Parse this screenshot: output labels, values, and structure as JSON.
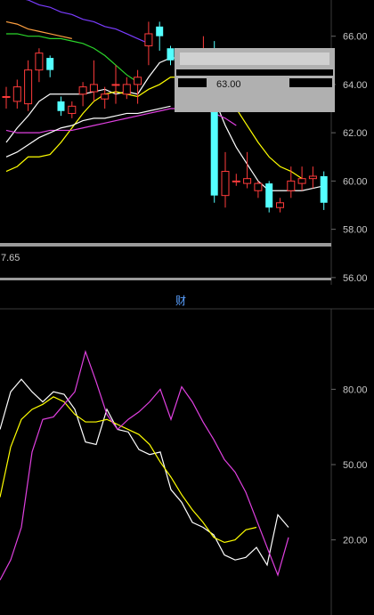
{
  "tab": {
    "label": "财"
  },
  "left_truncated_value": "7.65",
  "tooltip": {
    "value": "63.00"
  },
  "colors": {
    "background": "#000000",
    "panel_border": "#3a3a3a",
    "up_candle": "#ff3b3b",
    "down_candle": "#54ffff",
    "line_white": "#ffffff",
    "line_yellow": "#ffff00",
    "line_magenta": "#e040e0",
    "line_purple": "#7a3cff",
    "line_green": "#2bd62b",
    "line_orange": "#ffa040",
    "tooltip_bg": "#b0b0b0",
    "separator": "#9a9a9a"
  },
  "chart_data": [
    {
      "type": "candlestick",
      "title": "",
      "ylim": [
        55.7,
        67.5
      ],
      "yticks": [
        56.0,
        58.0,
        60.0,
        62.0,
        64.0,
        66.0
      ],
      "ytick_labels": [
        "56.00",
        "58.00",
        "60.00",
        "62.00",
        "64.00",
        "66.00"
      ],
      "candles": [
        {
          "o": 63.5,
          "c": 63.5,
          "h": 63.9,
          "l": 63.0
        },
        {
          "o": 63.3,
          "c": 63.9,
          "h": 64.2,
          "l": 63.0
        },
        {
          "o": 63.2,
          "c": 64.6,
          "h": 65.0,
          "l": 62.9
        },
        {
          "o": 64.6,
          "c": 65.3,
          "h": 65.5,
          "l": 64.1
        },
        {
          "o": 65.1,
          "c": 64.6,
          "h": 65.2,
          "l": 64.3
        },
        {
          "o": 63.3,
          "c": 62.9,
          "h": 63.5,
          "l": 62.7
        },
        {
          "o": 62.8,
          "c": 63.1,
          "h": 63.3,
          "l": 62.6
        },
        {
          "o": 63.6,
          "c": 63.9,
          "h": 64.1,
          "l": 63.1
        },
        {
          "o": 63.7,
          "c": 64.0,
          "h": 65.0,
          "l": 63.3
        },
        {
          "o": 63.4,
          "c": 63.6,
          "h": 63.9,
          "l": 63.0
        },
        {
          "o": 64.0,
          "c": 64.0,
          "h": 64.8,
          "l": 63.2
        },
        {
          "o": 63.6,
          "c": 64.0,
          "h": 64.3,
          "l": 63.4
        },
        {
          "o": 64.0,
          "c": 64.3,
          "h": 64.6,
          "l": 63.2
        },
        {
          "o": 65.6,
          "c": 66.1,
          "h": 66.6,
          "l": 64.8
        },
        {
          "o": 66.4,
          "c": 66.0,
          "h": 66.6,
          "l": 65.4
        },
        {
          "o": 65.5,
          "c": 65.0,
          "h": 65.6,
          "l": 64.8
        },
        {
          "o": 64.8,
          "c": 65.1,
          "h": 65.5,
          "l": 64.7
        },
        {
          "o": 64.9,
          "c": 64.1,
          "h": 65.0,
          "l": 63.7
        },
        {
          "o": 64.0,
          "c": 65.4,
          "h": 66.0,
          "l": 63.9
        },
        {
          "o": 65.5,
          "c": 59.4,
          "h": 65.8,
          "l": 59.1
        },
        {
          "o": 59.4,
          "c": 60.4,
          "h": 61.2,
          "l": 58.9
        },
        {
          "o": 60.0,
          "c": 60.0,
          "h": 60.3,
          "l": 59.8
        },
        {
          "o": 59.9,
          "c": 60.1,
          "h": 61.2,
          "l": 59.7
        },
        {
          "o": 59.6,
          "c": 59.9,
          "h": 60.0,
          "l": 59.3
        },
        {
          "o": 59.9,
          "c": 58.9,
          "h": 60.0,
          "l": 58.7
        },
        {
          "o": 58.9,
          "c": 59.1,
          "h": 59.3,
          "l": 58.7
        },
        {
          "o": 59.6,
          "c": 60.0,
          "h": 60.6,
          "l": 59.3
        },
        {
          "o": 59.9,
          "c": 60.1,
          "h": 60.6,
          "l": 59.6
        },
        {
          "o": 60.1,
          "c": 60.2,
          "h": 60.6,
          "l": 59.7
        },
        {
          "o": 60.2,
          "c": 59.1,
          "h": 60.4,
          "l": 58.8
        }
      ],
      "series": [
        {
          "color": "#ffffff",
          "values": [
            61.6,
            62.2,
            62.7,
            63.3,
            63.6,
            63.6,
            63.6,
            63.6,
            63.7,
            63.8,
            63.6,
            63.7,
            63.6,
            64.3,
            64.9,
            65.1,
            65.1,
            65.3,
            65.2,
            63.4,
            62.3,
            61.4,
            60.7,
            60.0,
            59.6,
            59.6,
            59.6,
            59.6,
            59.7,
            59.8
          ]
        },
        {
          "color": "#ffff00",
          "values": [
            60.4,
            60.6,
            61.0,
            61.0,
            61.1,
            61.6,
            62.2,
            62.8,
            63.3,
            63.6,
            63.7,
            63.6,
            63.5,
            63.8,
            64.0,
            64.3,
            64.3,
            64.4,
            64.3,
            63.9,
            63.6,
            63.0,
            62.3,
            61.6,
            61.0,
            60.6,
            60.4,
            60.1
          ]
        },
        {
          "color": "#e040e0",
          "values": [
            62.1,
            62.0,
            62.0,
            62.0,
            62.1,
            62.1,
            62.1,
            62.2,
            62.3,
            62.4,
            62.5,
            62.6,
            62.7,
            62.8,
            62.9,
            63.0,
            63.0,
            63.0,
            63.0,
            62.8,
            62.6,
            62.3
          ]
        },
        {
          "color": "#ffffff",
          "values": [
            61.0,
            61.2,
            61.5,
            61.8,
            62.0,
            62.2,
            62.3,
            62.5,
            62.6,
            62.6,
            62.7,
            62.8,
            62.8,
            62.9,
            63.0,
            63.1
          ]
        },
        {
          "color": "#7a3cff",
          "values": [
            67.8,
            67.6,
            67.5,
            67.3,
            67.2,
            67.0,
            66.9,
            66.7,
            66.6,
            66.4,
            66.3,
            66.1,
            65.9,
            65.7
          ]
        },
        {
          "color": "#2bd62b",
          "values": [
            66.1,
            66.1,
            66.0,
            66.0,
            65.9,
            65.9,
            65.8,
            65.7,
            65.5,
            65.2,
            64.8,
            64.4,
            64.1
          ]
        },
        {
          "color": "#ffa040",
          "values": [
            66.6,
            66.5,
            66.3,
            66.2,
            66.1,
            66.0,
            65.9
          ]
        }
      ]
    },
    {
      "type": "line",
      "title": "",
      "ylim": [
        0,
        100
      ],
      "yticks": [
        20.0,
        50.0,
        80.0
      ],
      "ytick_labels": [
        "20.00",
        "50.00",
        "80.00"
      ],
      "series": [
        {
          "color": "#ffffff",
          "values": [
            64,
            79,
            84,
            79,
            75,
            79,
            78,
            72,
            59,
            58,
            72,
            64,
            63,
            56,
            54,
            55,
            40,
            35,
            27,
            25,
            22,
            14,
            12,
            13,
            17,
            10,
            30,
            25
          ]
        },
        {
          "color": "#ffff00",
          "values": [
            37,
            57,
            68,
            72,
            74,
            77,
            75,
            70,
            67,
            67,
            68,
            66,
            64,
            62,
            58,
            51,
            45,
            38,
            32,
            27,
            21,
            19,
            20,
            24,
            25
          ]
        },
        {
          "color": "#e040e0",
          "values": [
            4,
            12,
            25,
            55,
            68,
            69,
            74,
            79,
            95,
            83,
            70,
            64,
            68,
            71,
            75,
            80,
            68,
            81,
            75,
            67,
            60,
            52,
            47,
            39,
            28,
            17,
            6,
            21
          ]
        }
      ]
    }
  ]
}
